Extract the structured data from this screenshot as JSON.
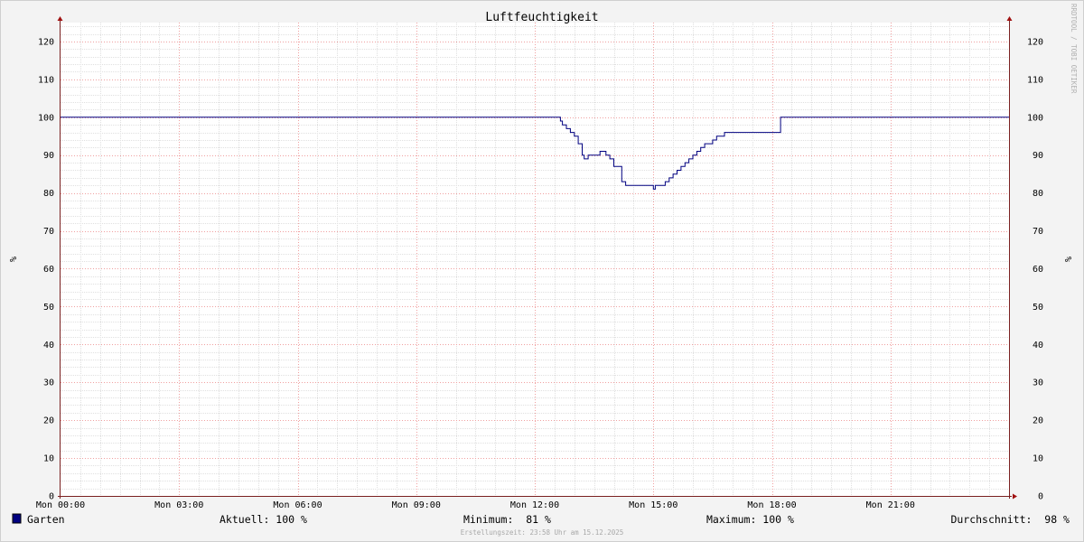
{
  "chart_data": {
    "type": "line",
    "title": "Luftfeuchtigkeit",
    "ylabel_left": "%",
    "ylabel_right": "%",
    "ylim": [
      0,
      125
    ],
    "yticks": [
      0,
      10,
      20,
      30,
      40,
      50,
      60,
      70,
      80,
      90,
      100,
      110,
      120
    ],
    "xlim": [
      "00:00",
      "24:00"
    ],
    "xticks": [
      {
        "t": 0,
        "label": "Mon 00:00"
      },
      {
        "t": 3,
        "label": "Mon 03:00"
      },
      {
        "t": 6,
        "label": "Mon 06:00"
      },
      {
        "t": 9,
        "label": "Mon 09:00"
      },
      {
        "t": 12,
        "label": "Mon 12:00"
      },
      {
        "t": 15,
        "label": "Mon 15:00"
      },
      {
        "t": 18,
        "label": "Mon 18:00"
      },
      {
        "t": 21,
        "label": "Mon 21:00"
      }
    ],
    "grid": true,
    "series": [
      {
        "name": "Garten",
        "color": "#000080",
        "x": [
          0,
          12.6,
          12.65,
          12.7,
          12.8,
          12.9,
          13.0,
          13.1,
          13.2,
          13.25,
          13.3,
          13.35,
          13.45,
          13.55,
          13.65,
          13.7,
          13.75,
          13.8,
          13.9,
          14.0,
          14.1,
          14.2,
          14.3,
          14.35,
          14.45,
          14.55,
          14.6,
          14.65,
          14.7,
          14.75,
          14.8,
          14.9,
          15.0,
          15.05,
          15.1,
          15.15,
          15.2,
          15.3,
          15.4,
          15.5,
          15.6,
          15.7,
          15.8,
          15.9,
          16.0,
          16.1,
          16.2,
          16.3,
          16.4,
          16.5,
          16.6,
          16.7,
          16.8,
          16.9,
          17.0,
          17.1,
          17.5,
          18.0,
          18.2,
          18.22,
          24.0
        ],
        "y": [
          100,
          100,
          99,
          98,
          97,
          96,
          95,
          93,
          90,
          89,
          89,
          90,
          90,
          90,
          91,
          91,
          91,
          90,
          89,
          87,
          87,
          83,
          82,
          82,
          82,
          82,
          82,
          82,
          82,
          82,
          82,
          82,
          81,
          82,
          82,
          82,
          82,
          83,
          84,
          85,
          86,
          87,
          88,
          89,
          90,
          91,
          92,
          93,
          93,
          94,
          95,
          95,
          96,
          96,
          96,
          96,
          96,
          96,
          96,
          100,
          100
        ]
      }
    ],
    "legend": {
      "label": "Garten",
      "swatch_color": "#000080",
      "aktuell": "Aktuell: 100 %",
      "minimum": "Minimum:  81 %",
      "maximum": "Maximum: 100 %",
      "durchschnitt": "Durchschnitt:  98 %"
    },
    "footer": "Erstellungszeit: 23:58 Uhr am 15.12.2025",
    "watermark": "RRDTOOL / TOBI OETIKER"
  }
}
